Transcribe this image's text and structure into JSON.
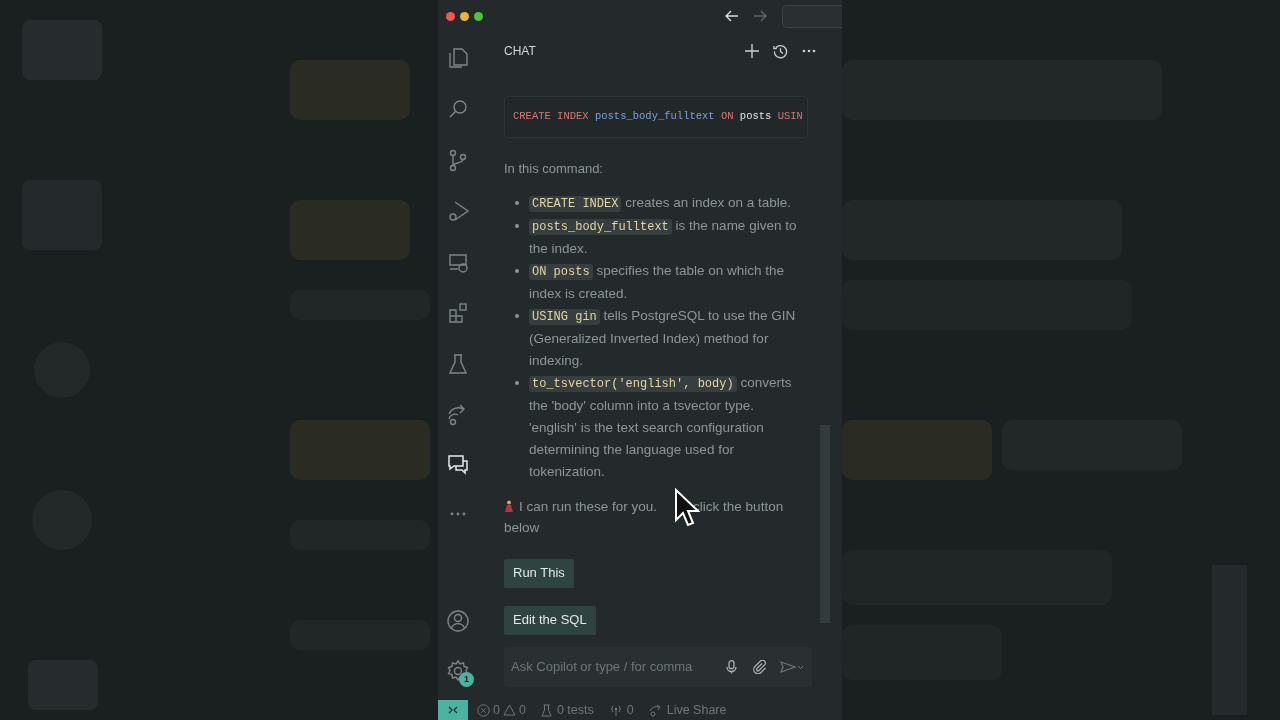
{
  "chat": {
    "title": "CHAT",
    "code_line": [
      {
        "text": "CREATE INDEX",
        "kind": "keyword"
      },
      {
        "text": "posts_body_fulltext",
        "kind": "ident"
      },
      {
        "text": "ON",
        "kind": "keyword"
      },
      {
        "text": "posts",
        "kind": "plain"
      },
      {
        "text": "USIN",
        "kind": "keyword"
      }
    ],
    "intro": "In this command:",
    "bullets": [
      {
        "code": "CREATE INDEX",
        "text": "creates an index on a table."
      },
      {
        "code": "posts_body_fulltext",
        "text": "is the name given to the index."
      },
      {
        "code": "ON posts",
        "text": "specifies the table on which the index is created."
      },
      {
        "code": "USING gin",
        "text": "tells PostgreSQL to use the GIN (Generalized Inverted Index) method for indexing."
      },
      {
        "code": "to_tsvector('english', body)",
        "text": "converts the 'body' column into a tsvector type. 'english' is the text search configuration determining the language used for tokenization."
      }
    ],
    "message_parts": [
      "I can run these for you.",
      "click the button",
      "below"
    ],
    "buttons": [
      "Run This",
      "Edit the SQL"
    ],
    "input": {
      "placeholder": "Ask Copilot or type / for comma"
    }
  },
  "activity_bar": {
    "settings_badge": "1"
  },
  "status_bar": {
    "errors": "0",
    "warnings": "0",
    "tests": "0 tests",
    "ports": "0",
    "live_share": "Live Share"
  }
}
